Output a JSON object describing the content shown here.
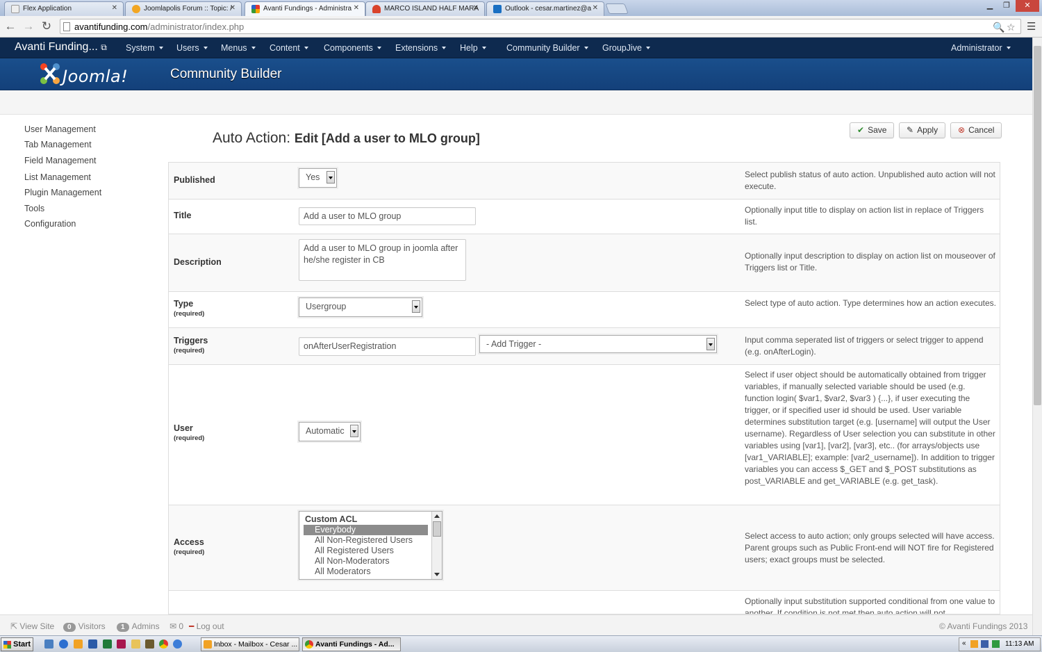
{
  "browser": {
    "tabs": [
      {
        "label": "Flex Application",
        "color": "#e8e8e8"
      },
      {
        "label": "Joomlapolis Forum :: Topic: /",
        "color": "#f2a623"
      },
      {
        "label": "Avanti Fundings - Administra",
        "color": "#f07b1d"
      },
      {
        "label": "MARCO ISLAND HALF MARA",
        "color": "#d9432b"
      },
      {
        "label": "Outlook - cesar.martinez@a",
        "color": "#1a6fc2"
      }
    ],
    "url_host": "avantifunding.com",
    "url_path": "/administrator/index.php"
  },
  "topnav": {
    "brand": "Avanti Funding...",
    "items": [
      "System",
      "Users",
      "Menus",
      "Content",
      "Components",
      "Extensions",
      "Help",
      "Community Builder",
      "GroupJive"
    ],
    "user": "Administrator"
  },
  "header": {
    "logo_text": "Joomla!",
    "title": "Community Builder"
  },
  "sidebar": {
    "items": [
      "User Management",
      "Tab Management",
      "Field Management",
      "List Management",
      "Plugin Management",
      "Tools",
      "Configuration"
    ]
  },
  "page": {
    "title_main": "Auto Action:",
    "title_sub": "Edit [Add a user to MLO group]"
  },
  "toolbar": {
    "save": "Save",
    "apply": "Apply",
    "cancel": "Cancel"
  },
  "form": {
    "required_label": "(required)",
    "published": {
      "label": "Published",
      "value": "Yes",
      "help": "Select publish status of auto action. Unpublished auto action will not execute."
    },
    "title": {
      "label": "Title",
      "value": "Add a user to MLO group",
      "help": "Optionally input title to display on action list in replace of Triggers list."
    },
    "description": {
      "label": "Description",
      "value": "Add a user to MLO group in joomla after he/she register in CB",
      "help": "Optionally input description to display on action list on mouseover of Triggers list or Title."
    },
    "type": {
      "label": "Type",
      "value": "Usergroup",
      "help": "Select type of auto action. Type determines how an action executes."
    },
    "triggers": {
      "label": "Triggers",
      "value": "onAfterUserRegistration",
      "add_trigger": "- Add Trigger -",
      "help": "Input comma seperated list of triggers or select trigger to append (e.g. onAfterLogin)."
    },
    "user": {
      "label": "User",
      "value": "Automatic",
      "help": "Select if user object should be automatically obtained from trigger variables, if manually selected variable should be used (e.g. function login( $var1, $var2, $var3 ) {...}, if user executing the trigger, or if specified user id should be used. User variable determines substitution target (e.g. [username] will output the User username). Regardless of User selection you can substitute in other variables using [var1], [var2], [var3], etc.. (for arrays/objects use [var1_VARIABLE]; example: [var2_username]). In addition to trigger variables you can access $_GET and $_POST substitutions as post_VARIABLE and get_VARIABLE (e.g. get_task)."
    },
    "access": {
      "label": "Access",
      "group": "Custom ACL",
      "options": [
        "Everybody",
        "All Non-Registered Users",
        "All Registered Users",
        "All Non-Moderators",
        "All Moderators"
      ],
      "selected": "Everybody",
      "help": "Select access to auto action; only groups selected will have access. Parent groups such as Public Front-end will NOT fire for Registered users; exact groups must be selected."
    },
    "conditional": {
      "help": "Optionally input substitution supported conditional from one value to another. If condition is not met then auto action will not"
    }
  },
  "footer": {
    "view_site": "View Site",
    "visitors_count": "0",
    "visitors": "Visitors",
    "admins_count": "1",
    "admins": "Admins",
    "messages_count": "0",
    "logout": "Log out",
    "copyright": "© Avanti Fundings 2013"
  },
  "taskbar": {
    "start": "Start",
    "tasks": [
      "Inbox - Mailbox - Cesar ...",
      "Avanti Fundings - Ad..."
    ],
    "clock": "11:13 AM"
  }
}
